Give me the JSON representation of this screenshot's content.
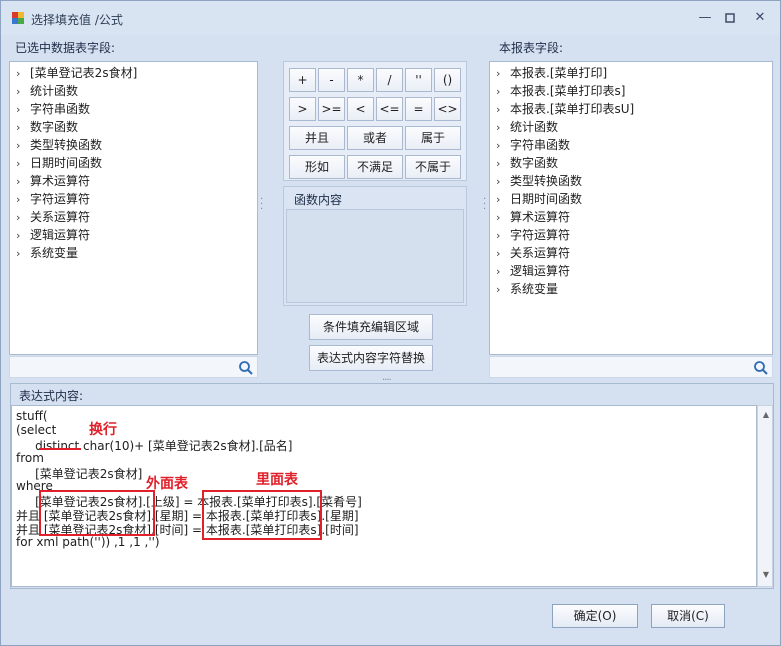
{
  "window": {
    "title": "选择填充值 /公式"
  },
  "left_panel": {
    "label": "已选中数据表字段:",
    "items": [
      "[菜单登记表2s食材]",
      "统计函数",
      "字符串函数",
      "数字函数",
      "类型转换函数",
      "日期时间函数",
      "算术运算符",
      "字符运算符",
      "关系运算符",
      "逻辑运算符",
      "系统变量"
    ]
  },
  "right_panel": {
    "label": "本报表字段:",
    "items": [
      "本报表.[菜单打印]",
      "本报表.[菜单打印表s]",
      "本报表.[菜单打印表sU]",
      "统计函数",
      "字符串函数",
      "数字函数",
      "类型转换函数",
      "日期时间函数",
      "算术运算符",
      "字符运算符",
      "关系运算符",
      "逻辑运算符",
      "系统变量"
    ]
  },
  "operators": {
    "row1": [
      "+",
      "-",
      "*",
      "/",
      "''",
      "()"
    ],
    "row2": [
      ">",
      ">=",
      "<",
      "<=",
      "=",
      "<>"
    ],
    "row3": [
      "并且",
      "或者",
      "属于"
    ],
    "row4": [
      "形如",
      "不满足",
      "不属于"
    ]
  },
  "func_group": {
    "title": "函数内容"
  },
  "actions": {
    "cond_edit": "条件填充编辑区域",
    "expr_replace": "表达式内容字符替换"
  },
  "expression": {
    "label": "表达式内容:",
    "lines": [
      "stuff(",
      "(select",
      "     distinct char(10)+ [菜单登记表2s食材].[品名]",
      "from",
      "     [菜单登记表2s食材]",
      "where",
      "     [菜单登记表2s食材].[上级] = 本报表.[菜单打印表s].[菜肴号]",
      "并且 [菜单登记表2s食材].[星期] = 本报表.[菜单打印表s].[星期]",
      "并且 [菜单登记表2s食材].[时间] = 本报表.[菜单打印表s].[时间]",
      "for xml path('')) ,1 ,1 ,'')"
    ]
  },
  "annotations": {
    "newline": "换行",
    "outer_table": "外面表",
    "inner_table": "里面表"
  },
  "buttons": {
    "ok": "确定(O)",
    "cancel": "取消(C)"
  },
  "colors": {
    "annotation": "#e0202a",
    "window_bg": "#d5e1f1"
  }
}
